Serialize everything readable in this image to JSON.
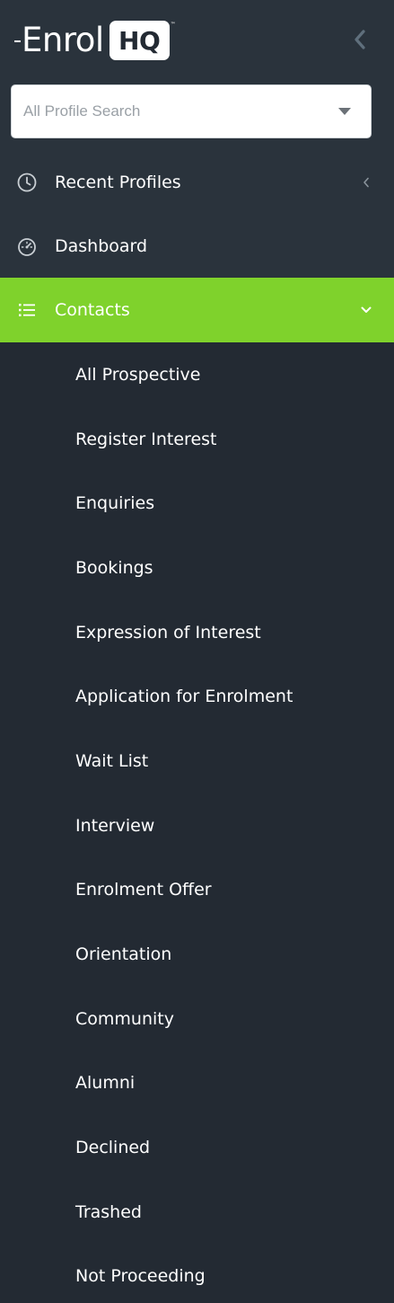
{
  "brand": {
    "wordmark": "Enrol",
    "badge": "HQ",
    "trademark": "™"
  },
  "search": {
    "placeholder": "All Profile Search"
  },
  "nav": {
    "recent_profiles": {
      "label": "Recent Profiles",
      "icon": "clock-icon"
    },
    "dashboard": {
      "label": "Dashboard",
      "icon": "speedometer-icon"
    },
    "contacts": {
      "label": "Contacts",
      "icon": "list-icon",
      "active_color": "#7fd22c"
    }
  },
  "contacts_submenu": [
    {
      "label": "All Prospective"
    },
    {
      "label": "Register Interest"
    },
    {
      "label": "Enquiries"
    },
    {
      "label": "Bookings"
    },
    {
      "label": "Expression of Interest"
    },
    {
      "label": "Application for Enrolment"
    },
    {
      "label": "Wait List"
    },
    {
      "label": "Interview"
    },
    {
      "label": "Enrolment Offer"
    },
    {
      "label": "Orientation"
    },
    {
      "label": "Community"
    },
    {
      "label": "Alumni"
    },
    {
      "label": "Declined"
    },
    {
      "label": "Trashed"
    },
    {
      "label": "Not Proceeding"
    }
  ],
  "colors": {
    "sidebar_bg": "#232a33",
    "top_bg": "#2a333c",
    "accent": "#7fd22c"
  }
}
